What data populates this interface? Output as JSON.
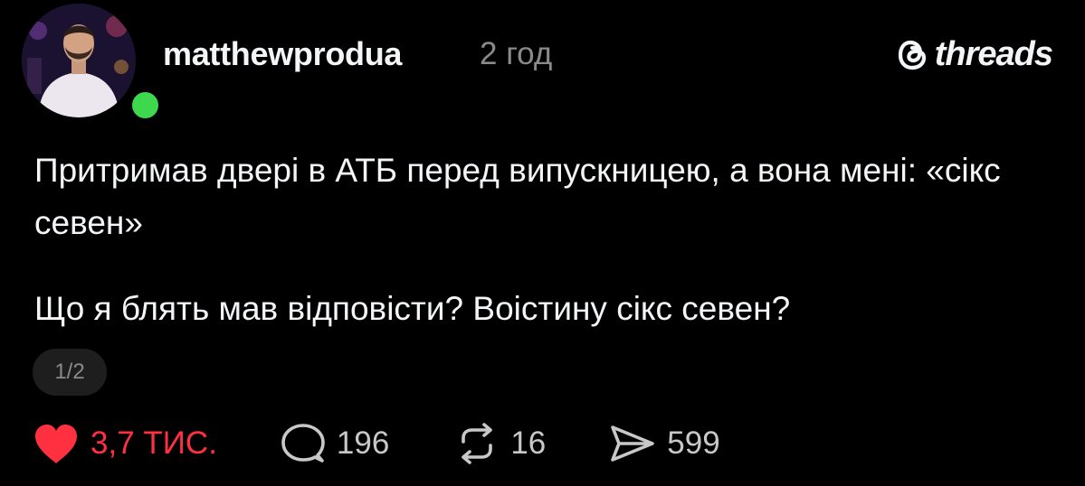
{
  "post": {
    "username": "matthewprodua",
    "timestamp": "2 год",
    "brand": "threads",
    "paragraphs": [
      "Притримав двері в АТБ перед випускницею, а вона мені: «сікс севен»",
      "Що я блять мав відповісти? Воістину сікс севен?"
    ],
    "pager": "1/2",
    "stats": {
      "likes": "3,7 ТИС.",
      "replies": "196",
      "reposts": "16",
      "shares": "599"
    },
    "icons": {
      "avatar": "profile-photo",
      "online": "online-status-dot",
      "brand": "threads-logo-icon",
      "like": "heart-icon",
      "reply": "comment-bubble-icon",
      "repost": "repost-icon",
      "share": "send-icon"
    },
    "colors": {
      "background": "#000000",
      "text": "#f3f5f7",
      "muted": "#8a8a8a",
      "liked": "#ff3040",
      "online": "#3dd84d"
    }
  }
}
